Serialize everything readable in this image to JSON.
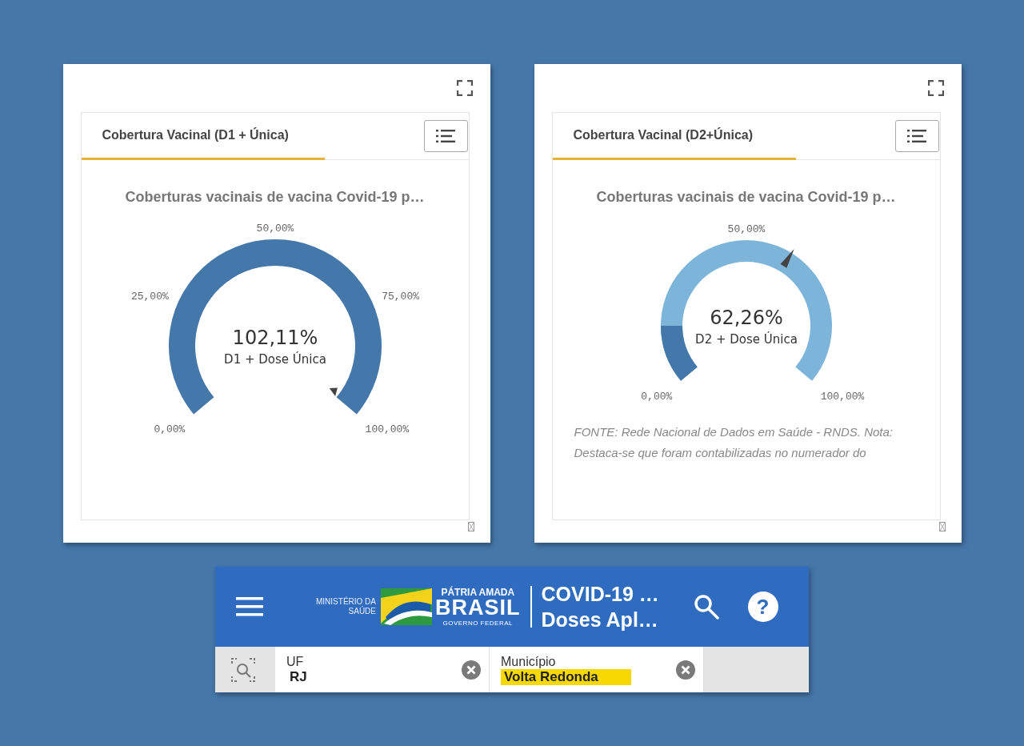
{
  "panels": [
    {
      "tab": {
        "label": "Cobertura Vacinal (D1 + Única)",
        "selected": true
      },
      "chart_title": "Coberturas vacinais de vacina Covid-19 p…",
      "gauge": {
        "kind": "fill",
        "level": 1,
        "value": "102,11%",
        "caption": "D1 + Dose Única",
        "ticks": [
          "0,00%",
          "25,00%",
          "50,00%",
          "75,00%",
          "100,00%"
        ]
      }
    },
    {
      "tab": {
        "label": "Cobertura Vacinal (D2+Única)",
        "selected": true
      },
      "chart_title": "Coberturas vacinais de vacina Covid-19 p…",
      "gauge": {
        "kind": "needle",
        "level": 0.6226,
        "value": "62,26%",
        "caption": "D2 + Dose Única",
        "ticks": [
          "0,00%",
          "50,00%",
          "100,00%"
        ]
      },
      "footnote": "FONTE: Rede Nacional de Dados em Saúde - RNDS. Nota: Destaca-se que foram contabilizadas no numerador do"
    }
  ],
  "header": {
    "ministry": [
      "MINISTÉRIO DA",
      "SAÚDE"
    ],
    "slogan": "PÁTRIA AMADA",
    "brand": "BRASIL",
    "government": "GOVERNO FEDERAL",
    "app_title": [
      "COVID-19 …",
      "Doses Apl…"
    ],
    "help": "?"
  },
  "filters": [
    {
      "label": "UF",
      "value": "RJ",
      "highlighted": false
    },
    {
      "label": "Município",
      "value": "Volta Redonda",
      "highlighted": true
    }
  ]
}
